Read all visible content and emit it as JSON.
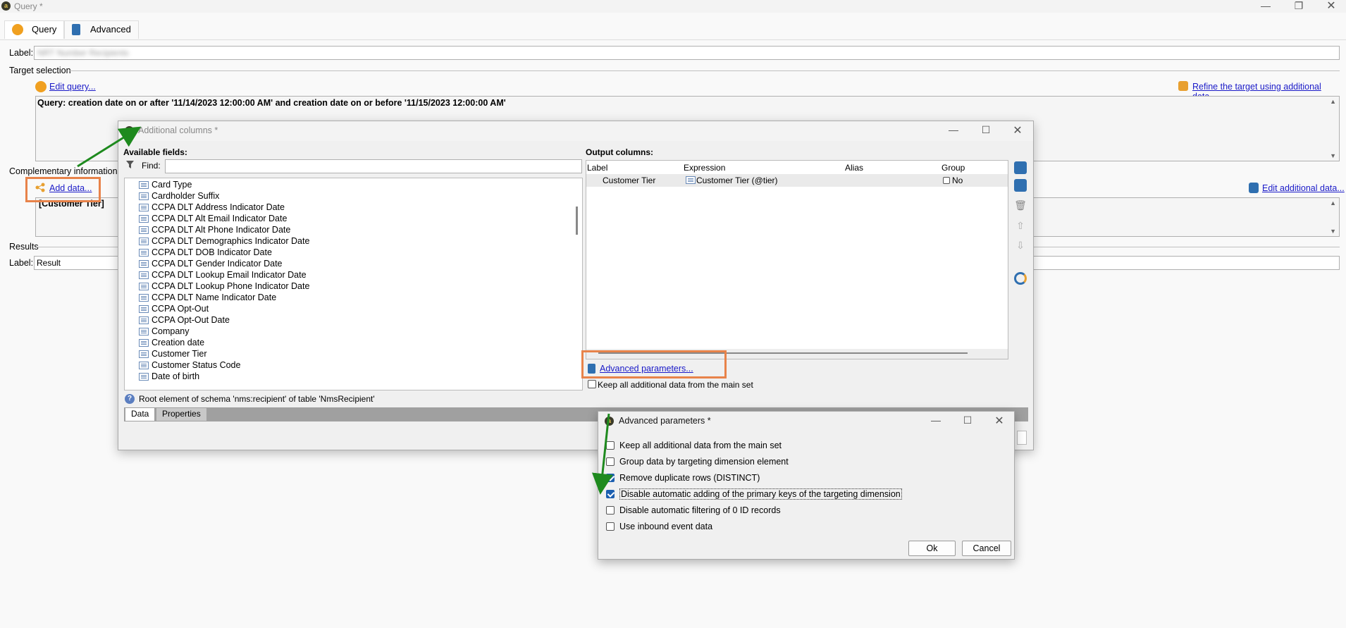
{
  "window": {
    "title": "Query *"
  },
  "tabs": [
    {
      "label": "Query"
    },
    {
      "label": "Advanced"
    }
  ],
  "label_field": {
    "label": "Label:",
    "value": "NRT Number Recipients"
  },
  "target_selection": {
    "heading": "Target selection",
    "edit_query": "Edit query...",
    "refine": "Refine the target using additional data...",
    "query_text": "Query: creation date on or after '11/14/2023 12:00:00 AM' and creation date on or before '11/15/2023 12:00:00 AM'"
  },
  "complementary": {
    "heading": "Complementary information",
    "add_data": "Add data...",
    "edit_additional": "Edit additional data...",
    "content": "[Customer Tier]"
  },
  "results": {
    "heading": "Results",
    "label": "Label:",
    "value": "Result"
  },
  "additional_columns": {
    "title": "Additional columns *",
    "available_fields": "Available fields:",
    "find_label": "Find:",
    "fields": [
      "Card Type",
      "Cardholder Suffix",
      "CCPA DLT Address Indicator Date",
      "CCPA DLT Alt Email Indicator Date",
      "CCPA DLT Alt Phone Indicator Date",
      "CCPA DLT Demographics Indicator Date",
      "CCPA DLT DOB Indicator Date",
      "CCPA DLT Gender Indicator Date",
      "CCPA DLT Lookup Email Indicator Date",
      "CCPA DLT Lookup Phone Indicator Date",
      "CCPA DLT Name Indicator Date",
      "CCPA Opt-Out",
      "CCPA Opt-Out Date",
      "Company",
      "Creation date",
      "Customer Tier",
      "Customer  Status  Code",
      "Date of birth"
    ],
    "output_columns": "Output columns:",
    "columns": {
      "label": "Label",
      "expression": "Expression",
      "alias": "Alias",
      "group": "Group"
    },
    "rows": [
      {
        "label": "Customer Tier",
        "expression": "Customer Tier (@tier)",
        "alias": "",
        "group": "No"
      }
    ],
    "advanced_params_link": "Advanced parameters...",
    "keep_all": "Keep all additional data from the main set",
    "root_info": "Root element of schema 'nms:recipient' of table 'NmsRecipient'",
    "bottom_tabs": [
      "Data",
      "Properties"
    ]
  },
  "advanced_parameters": {
    "title": "Advanced parameters *",
    "options": [
      {
        "label": "Keep all additional data from the main set",
        "checked": false
      },
      {
        "label": "Group data by targeting dimension element",
        "checked": false
      },
      {
        "label": "Remove duplicate rows (DISTINCT)",
        "checked": true
      },
      {
        "label": "Disable automatic adding of the primary keys of the targeting dimension",
        "checked": true
      },
      {
        "label": "Disable automatic filtering of 0 ID records",
        "checked": false
      },
      {
        "label": "Use inbound event data",
        "checked": false
      }
    ],
    "ok": "Ok",
    "cancel": "Cancel"
  },
  "colors": {
    "highlight": "#e8834a",
    "arrow": "#1e8a1e",
    "link": "#1a1ac8",
    "accent_orange": "#f0a020"
  }
}
